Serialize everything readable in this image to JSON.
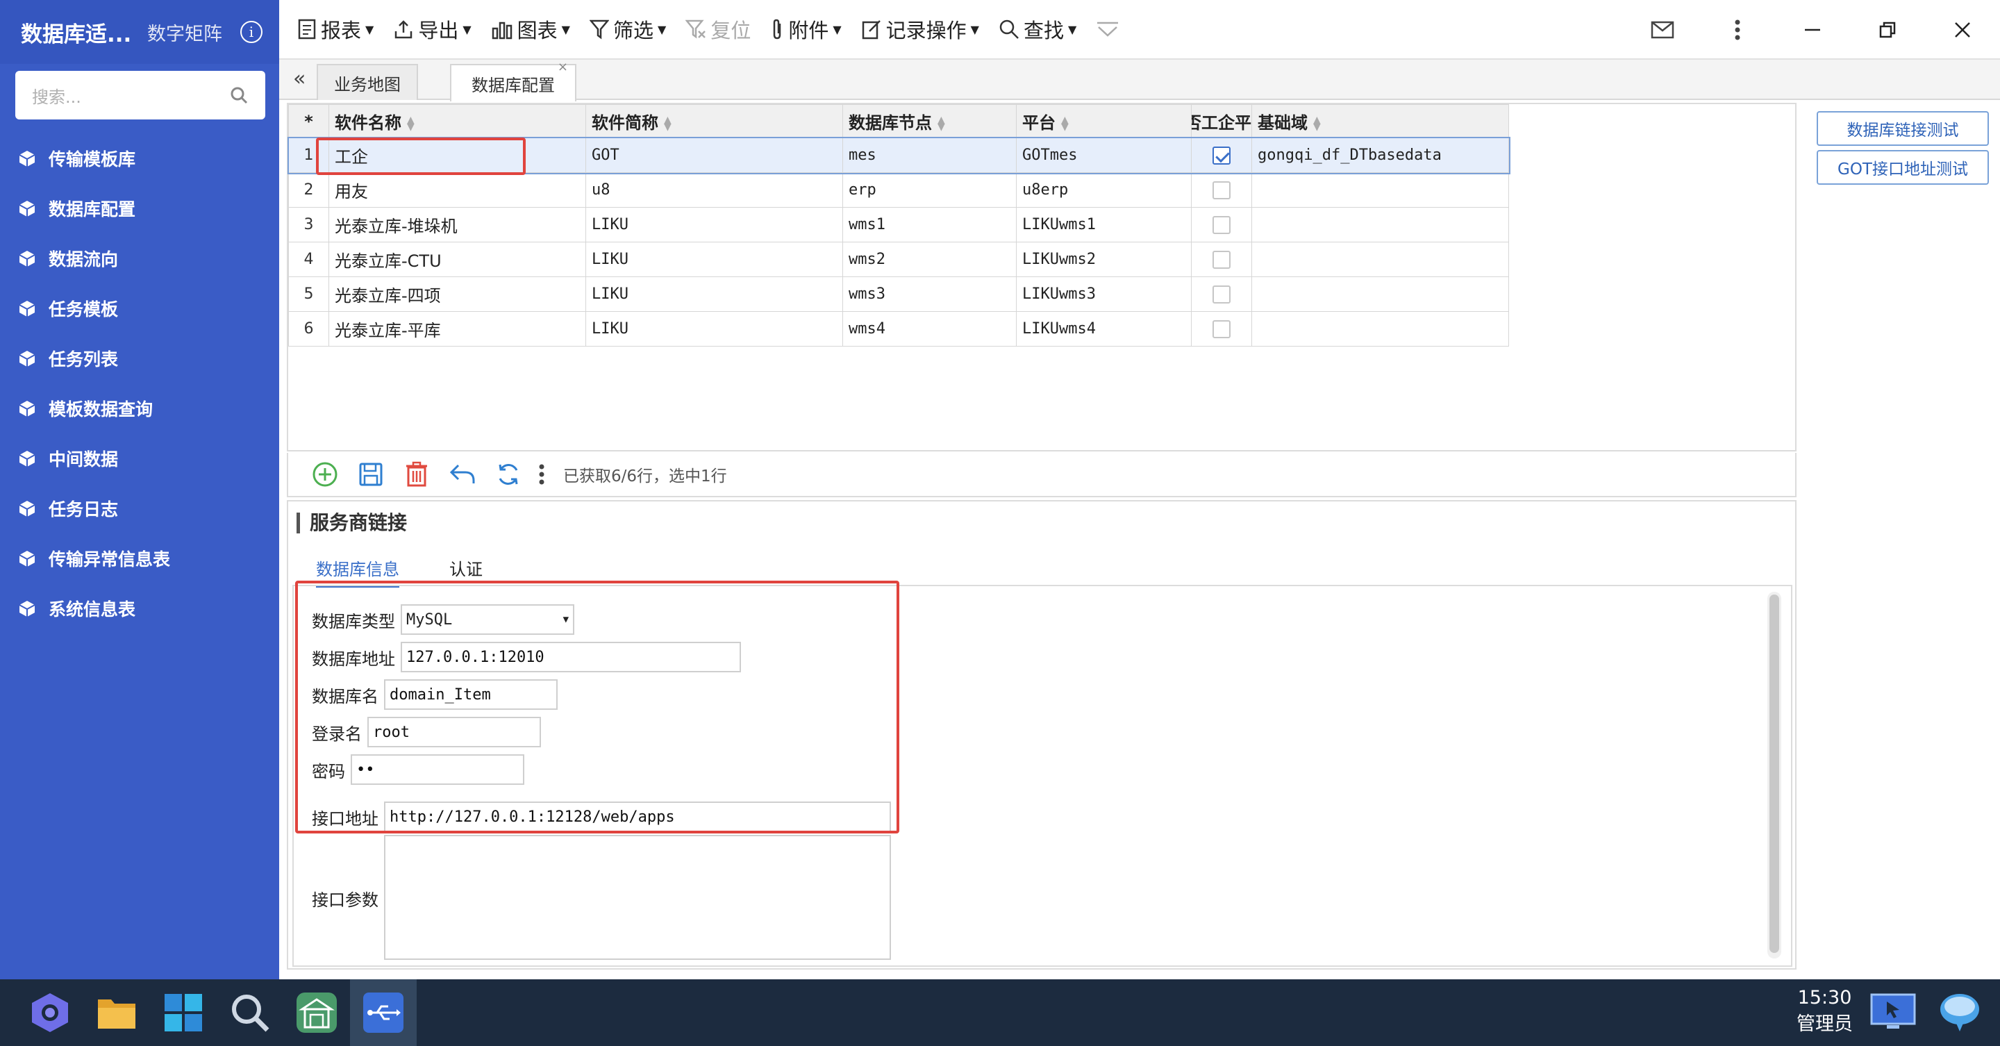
{
  "app": {
    "title": "数据库适...",
    "subtitle": "数字矩阵",
    "search_placeholder": "搜索..."
  },
  "sidebar": {
    "items": [
      {
        "label": "传输模板库"
      },
      {
        "label": "数据库配置"
      },
      {
        "label": "数据流向"
      },
      {
        "label": "任务模板"
      },
      {
        "label": "任务列表"
      },
      {
        "label": "模板数据查询"
      },
      {
        "label": "中间数据"
      },
      {
        "label": "任务日志"
      },
      {
        "label": "传输异常信息表"
      },
      {
        "label": "系统信息表"
      }
    ]
  },
  "toolbar": {
    "report": "报表",
    "export": "导出",
    "chart": "图表",
    "filter": "筛选",
    "reset": "复位",
    "attachment": "附件",
    "record_ops": "记录操作",
    "find": "查找"
  },
  "tabs": [
    {
      "label": "业务地图"
    },
    {
      "label": "数据库配置"
    }
  ],
  "grid": {
    "star": "*",
    "columns": [
      "软件名称",
      "软件简称",
      "数据库节点",
      "平台",
      "否工企平",
      "基础域"
    ],
    "rows": [
      {
        "n": "1",
        "name": "工企",
        "short": "GOT",
        "node": "mes",
        "platform": "GOTmes",
        "checked": true,
        "domain": "gongqi_df_DTbasedata"
      },
      {
        "n": "2",
        "name": "用友",
        "short": "u8",
        "node": "erp",
        "platform": "u8erp",
        "checked": false,
        "domain": ""
      },
      {
        "n": "3",
        "name": "光泰立库-堆垛机",
        "short": "LIKU",
        "node": "wms1",
        "platform": "LIKUwms1",
        "checked": false,
        "domain": ""
      },
      {
        "n": "4",
        "name": "光泰立库-CTU",
        "short": "LIKU",
        "node": "wms2",
        "platform": "LIKUwms2",
        "checked": false,
        "domain": ""
      },
      {
        "n": "5",
        "name": "光泰立库-四项",
        "short": "LIKU",
        "node": "wms3",
        "platform": "LIKUwms3",
        "checked": false,
        "domain": ""
      },
      {
        "n": "6",
        "name": "光泰立库-平库",
        "short": "LIKU",
        "node": "wms4",
        "platform": "LIKUwms4",
        "checked": false,
        "domain": ""
      }
    ],
    "status": "已获取6/6行，选中1行"
  },
  "right_buttons": {
    "db_test": "数据库链接测试",
    "got_test": "GOT接口地址测试"
  },
  "form": {
    "title": "服务商链接",
    "tab_db": "数据库信息",
    "tab_auth": "认证",
    "db_type_label": "数据库类型",
    "db_type_value": "MySQL",
    "db_addr_label": "数据库地址",
    "db_addr_value": "127.0.0.1:12010",
    "db_name_label": "数据库名",
    "db_name_value": "domain_Item",
    "login_label": "登录名",
    "login_value": "root",
    "password_label": "密码",
    "password_value": "••",
    "api_addr_label": "接口地址",
    "api_addr_value": "http://127.0.0.1:12128/web/apps",
    "api_params_label": "接口参数"
  },
  "taskbar": {
    "time": "15:30",
    "user": "管理员"
  },
  "colors": {
    "sidebar": "#3a5cc6",
    "accent": "#3a6fc8",
    "highlight_box": "#e0443e",
    "taskbar": "#1c2b3f"
  }
}
